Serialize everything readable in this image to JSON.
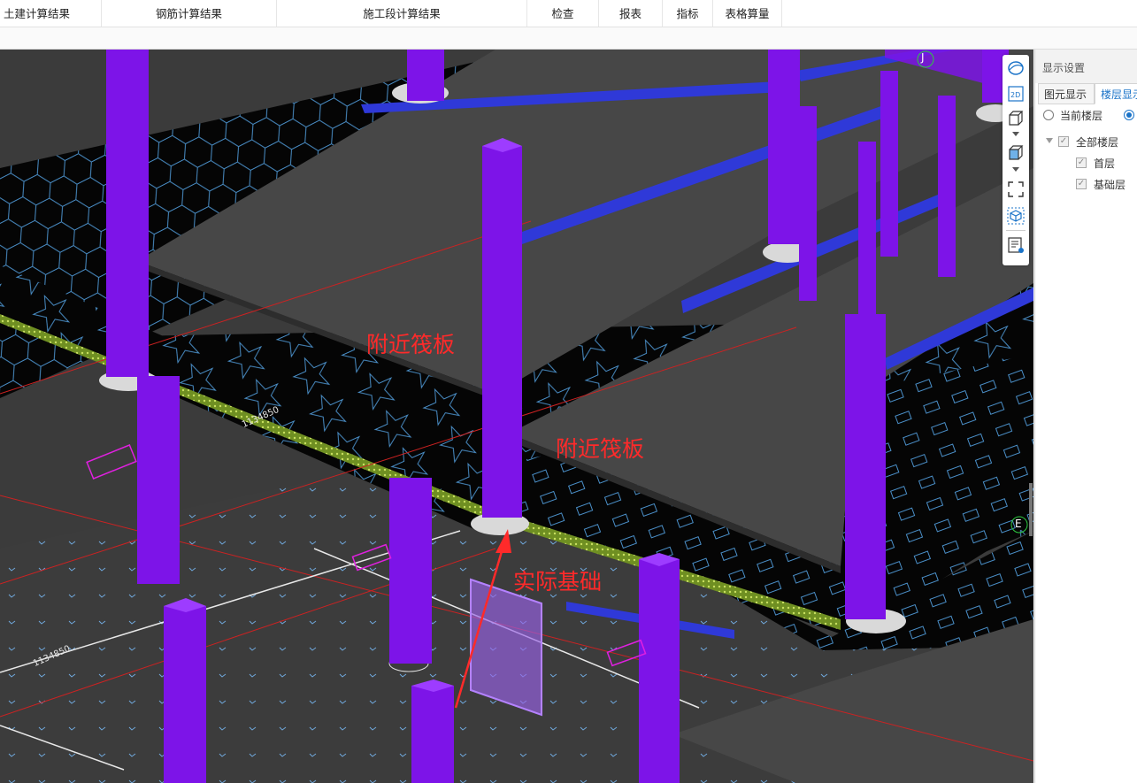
{
  "top_tabs": [
    "土建计算结果",
    "钢筋计算结果",
    "施工段计算结果",
    "检查",
    "报表",
    "指标",
    "表格算量"
  ],
  "viewport": {
    "annotations": [
      "附近筏板",
      "附近筏板",
      "实际基础"
    ],
    "grid_labels": [
      "J",
      "E"
    ],
    "dims": [
      "1134850",
      "1134850"
    ],
    "colors": {
      "column": "#7d14e8",
      "beam": "#2f39d8",
      "slab": "#474747",
      "raft": "#050505",
      "annotation": "#ff2a2a"
    }
  },
  "toolbar": {
    "icons": [
      "orbit-icon",
      "2d-view-icon",
      "3d-box-icon",
      "view-dropdown-icon",
      "3d-solid-icon",
      "dropdown-icon",
      "fullscreen-icon",
      "cube-select-icon",
      "display-settings-icon"
    ]
  },
  "panel": {
    "title": "显示设置",
    "tabs": [
      "图元显示",
      "楼层显示"
    ],
    "radio_current": "当前楼层",
    "tree": {
      "root": "全部楼层",
      "children": [
        "首层",
        "基础层"
      ]
    }
  }
}
